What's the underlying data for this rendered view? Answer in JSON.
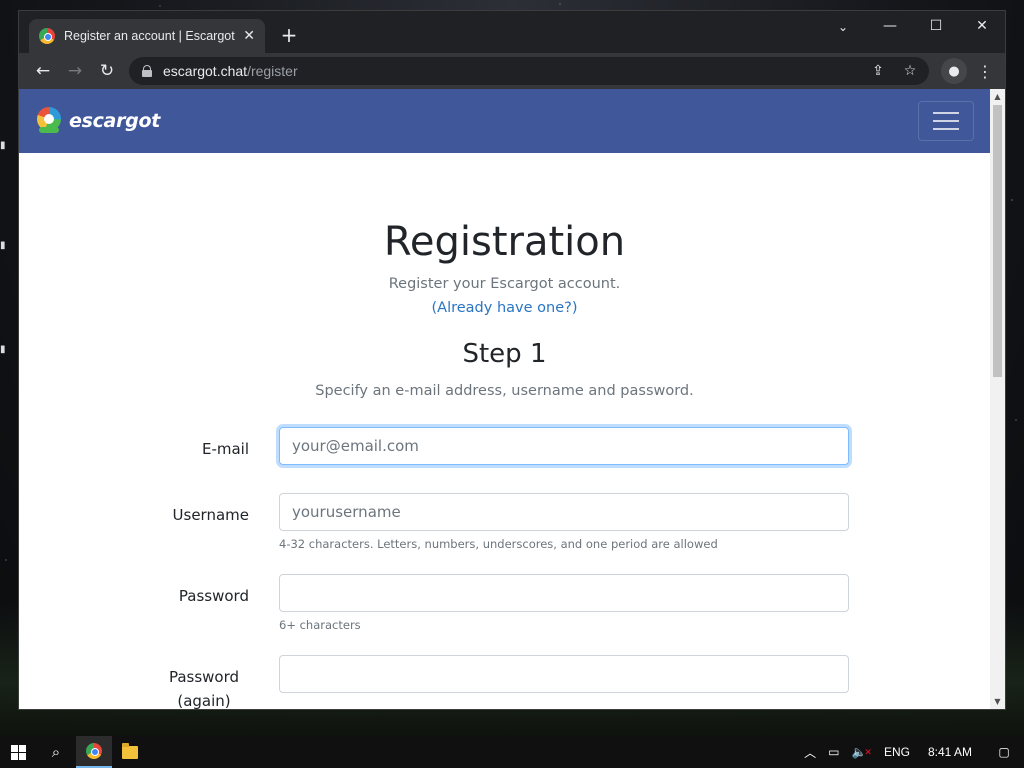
{
  "browser": {
    "tab_title": "Register an account | Escargot Chat",
    "tab_close": "✕",
    "new_tab": "+",
    "window_controls": {
      "minimize": "—",
      "maximize": "☐",
      "close": "✕"
    },
    "tab_search": "⌄",
    "nav": {
      "back": "←",
      "forward": "→",
      "reload": "↻"
    },
    "url_host": "escargot.chat",
    "url_path": "/register"
  },
  "site": {
    "brand": "escargot",
    "heading": "Registration",
    "subtitle": "Register your Escargot account.",
    "already_link": "(Already have one?)",
    "step_title": "Step 1",
    "step_subtitle": "Specify an e-mail address, username and password."
  },
  "form": {
    "email": {
      "label": "E-mail",
      "placeholder": "your@email.com",
      "value": ""
    },
    "username": {
      "label": "Username",
      "placeholder": "yourusername",
      "value": "",
      "help": "4-32 characters. Letters, numbers, underscores, and one period are allowed"
    },
    "password": {
      "label": "Password",
      "placeholder": "",
      "value": "",
      "help": "6+ characters"
    },
    "password_again": {
      "label": "Password (again)",
      "placeholder": "",
      "value": ""
    }
  },
  "taskbar": {
    "language": "ENG",
    "time": "8:41 AM"
  },
  "colors": {
    "navbar": "#40579a",
    "link": "#2a75c4",
    "focus_border": "#80bdff"
  }
}
